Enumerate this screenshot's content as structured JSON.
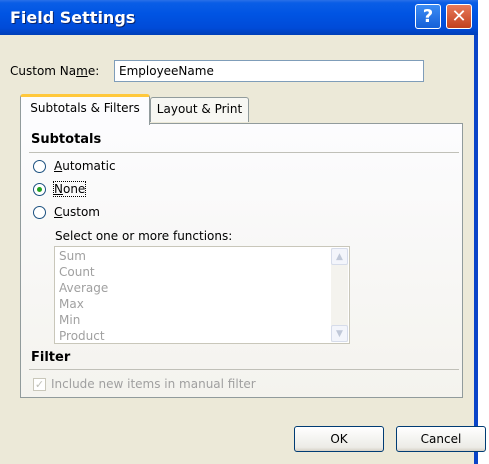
{
  "window": {
    "title": "Field Settings",
    "help_glyph": "?",
    "close_glyph": "✕"
  },
  "custom_name": {
    "label_pre": "Custom Na",
    "label_accel": "m",
    "label_post": "e:",
    "value": "EmployeeName"
  },
  "tabs": [
    {
      "label": "Subtotals & Filters",
      "active": true
    },
    {
      "label": "Layout & Print",
      "active": false
    }
  ],
  "subtotals": {
    "heading": "Subtotals",
    "options": [
      {
        "accel": "A",
        "rest": "utomatic",
        "selected": false
      },
      {
        "accel": "N",
        "rest": "one",
        "selected": true
      },
      {
        "accel": "C",
        "rest": "ustom",
        "selected": false
      }
    ],
    "functions_label": "Select one or more functions:",
    "functions": [
      "Sum",
      "Count",
      "Average",
      "Max",
      "Min",
      "Product"
    ]
  },
  "filter": {
    "heading": "Filter",
    "include_label": "Include new items in manual filter",
    "include_checked": true,
    "disabled": true
  },
  "buttons": {
    "ok": "OK",
    "cancel": "Cancel"
  }
}
